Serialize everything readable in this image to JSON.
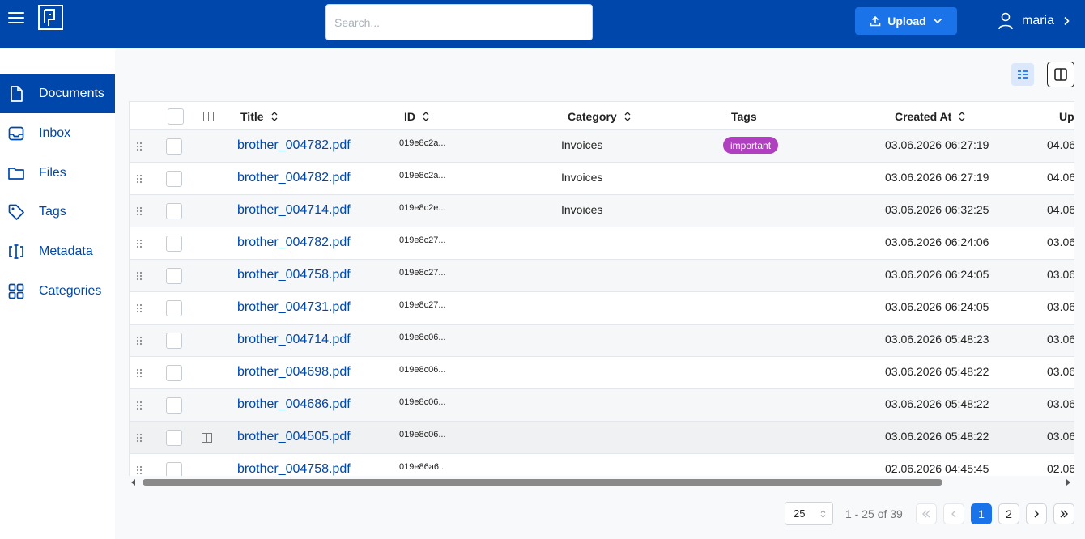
{
  "header": {
    "search_placeholder": "Search...",
    "upload_label": "Upload",
    "username": "maria"
  },
  "sidebar": {
    "items": [
      {
        "label": "Documents",
        "icon": "document-icon",
        "active": true
      },
      {
        "label": "Inbox",
        "icon": "inbox-icon",
        "active": false
      },
      {
        "label": "Files",
        "icon": "folder-icon",
        "active": false
      },
      {
        "label": "Tags",
        "icon": "tag-icon",
        "active": false
      },
      {
        "label": "Metadata",
        "icon": "metadata-icon",
        "active": false
      },
      {
        "label": "Categories",
        "icon": "grid-icon",
        "active": false
      }
    ]
  },
  "table": {
    "columns": {
      "title": "Title",
      "id": "ID",
      "category": "Category",
      "tags": "Tags",
      "created_at": "Created At",
      "updated_at": "Upd"
    },
    "rows": [
      {
        "title": "brother_004782.pdf",
        "id": "019e8c2a...",
        "category": "Invoices",
        "tag": "important",
        "created": "03.06.2026 06:27:19",
        "updated": "04.06"
      },
      {
        "title": "brother_004782.pdf",
        "id": "019e8c2a...",
        "category": "Invoices",
        "tag": "",
        "created": "03.06.2026 06:27:19",
        "updated": "04.06"
      },
      {
        "title": "brother_004714.pdf",
        "id": "019e8c2e...",
        "category": "Invoices",
        "tag": "",
        "created": "03.06.2026 06:32:25",
        "updated": "04.06"
      },
      {
        "title": "brother_004782.pdf",
        "id": "019e8c27...",
        "category": "",
        "tag": "",
        "created": "03.06.2026 06:24:06",
        "updated": "03.06"
      },
      {
        "title": "brother_004758.pdf",
        "id": "019e8c27...",
        "category": "",
        "tag": "",
        "created": "03.06.2026 06:24:05",
        "updated": "03.06"
      },
      {
        "title": "brother_004731.pdf",
        "id": "019e8c27...",
        "category": "",
        "tag": "",
        "created": "03.06.2026 06:24:05",
        "updated": "03.06"
      },
      {
        "title": "brother_004714.pdf",
        "id": "019e8c06...",
        "category": "",
        "tag": "",
        "created": "03.06.2026 05:48:23",
        "updated": "03.06"
      },
      {
        "title": "brother_004698.pdf",
        "id": "019e8c06...",
        "category": "",
        "tag": "",
        "created": "03.06.2026 05:48:22",
        "updated": "03.06"
      },
      {
        "title": "brother_004686.pdf",
        "id": "019e8c06...",
        "category": "",
        "tag": "",
        "created": "03.06.2026 05:48:22",
        "updated": "03.06"
      },
      {
        "title": "brother_004505.pdf",
        "id": "019e8c06...",
        "category": "",
        "tag": "",
        "created": "03.06.2026 05:48:22",
        "updated": "03.06"
      },
      {
        "title": "brother_004758.pdf",
        "id": "019e86a6...",
        "category": "",
        "tag": "",
        "created": "02.06.2026 04:45:45",
        "updated": "02.06"
      }
    ]
  },
  "pagination": {
    "page_size": "25",
    "info": "1 - 25 of 39",
    "pages": [
      "1",
      "2"
    ],
    "current_page": "1"
  },
  "colors": {
    "brand": "#0047ab",
    "accent": "#1a73e8",
    "tag_important": "#b040c0"
  }
}
